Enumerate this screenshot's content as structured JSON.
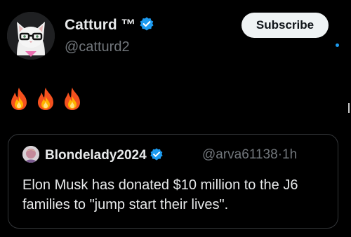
{
  "post": {
    "display_name": "Catturd ™",
    "handle": "@catturd2",
    "subscribe_label": "Subscribe",
    "body_emojis": [
      "fire",
      "fire",
      "fire"
    ]
  },
  "quote": {
    "display_name": "Blondelady2024",
    "handle": "@arva61138",
    "separator": "·",
    "time": "1h",
    "text": "Elon Musk has donated $10 million to the J6 families to \"jump start their lives\"."
  },
  "colors": {
    "background": "#000000",
    "verified": "#1d9bf0",
    "muted_text": "#71767b",
    "button_bg": "#eff3f4"
  }
}
